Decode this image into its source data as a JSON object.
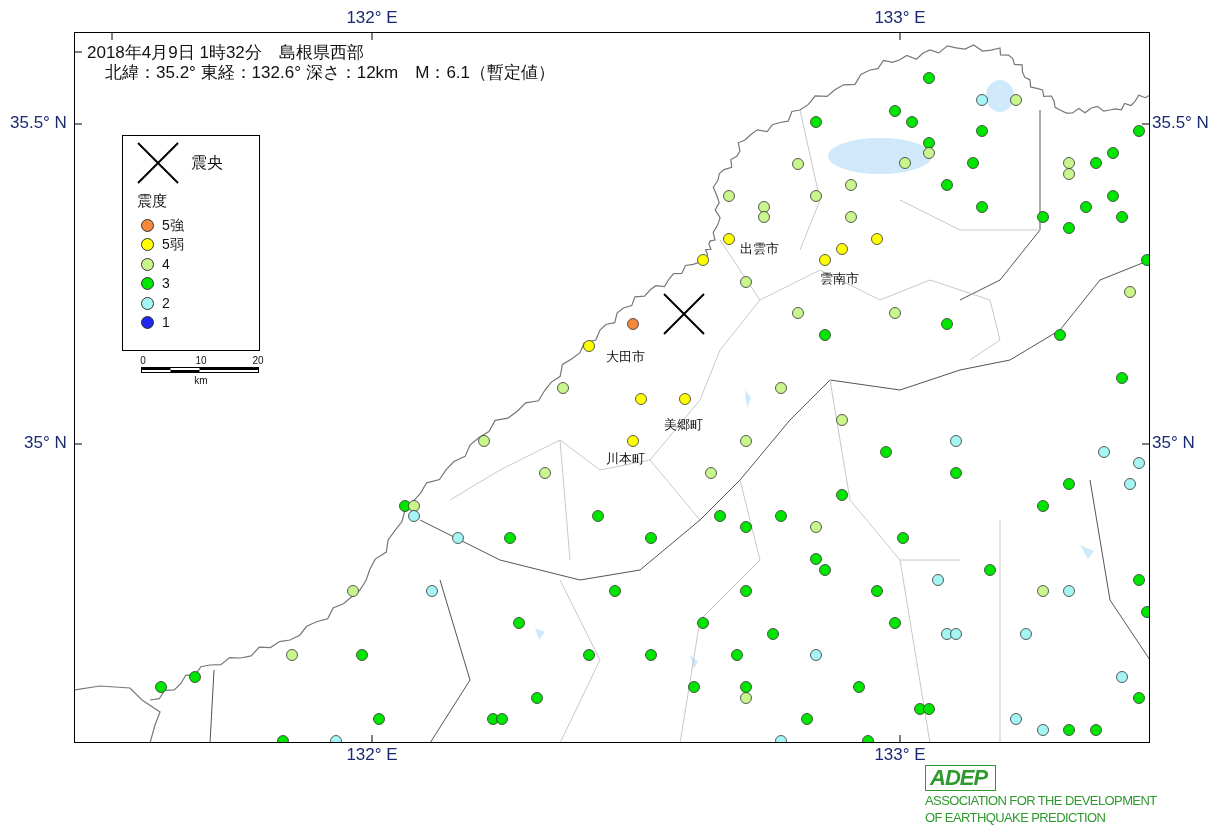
{
  "header": {
    "line_1": "2018年4月9日 1時32分　島根県西部",
    "line_2": "北緯：35.2°  東経：132.6°  深さ：12km　M：6.1（暫定値）"
  },
  "axes": {
    "top": [
      "132° E",
      "133° E"
    ],
    "bottom": [
      "132° E",
      "133° E"
    ],
    "left": [
      "35.5° N",
      "35° N"
    ],
    "right": [
      "35.5° N",
      "35° N"
    ]
  },
  "legend": {
    "epicenter_label": "震央",
    "intensity_title": "震度",
    "intensity_levels": [
      {
        "label": "5強",
        "color": "#f5883a"
      },
      {
        "label": "5弱",
        "color": "#ffff00"
      },
      {
        "label": "4",
        "color": "#c8f58c"
      },
      {
        "label": "3",
        "color": "#00e600"
      },
      {
        "label": "2",
        "color": "#a5f5f5"
      },
      {
        "label": "1",
        "color": "#1e28f0"
      }
    ],
    "scale": {
      "ticks": [
        "0",
        "10",
        "20"
      ],
      "unit": "km"
    }
  },
  "place_labels": [
    "出雲市",
    "雲南市",
    "大田市",
    "美郷町",
    "川本町"
  ],
  "stations": [
    {
      "color": "#00e600"
    },
    {
      "color": "#c8f58c"
    },
    {
      "color": "#a5f5f5"
    },
    {
      "color": "#00e600"
    },
    {
      "color": "#00e600"
    },
    {
      "color": "#00e600"
    },
    {
      "color": "#00e600"
    },
    {
      "color": "#00e600"
    },
    {
      "color": "#00e600"
    },
    {
      "color": "#c8f58c"
    },
    {
      "color": "#c8f58c"
    },
    {
      "color": "#00e600"
    },
    {
      "color": "#c8f58c"
    },
    {
      "color": "#00e600"
    },
    {
      "color": "#00e600"
    },
    {
      "color": "#c8f58c"
    },
    {
      "color": "#c8f58c"
    },
    {
      "color": "#c8f58c"
    },
    {
      "color": "#c8f58c"
    },
    {
      "color": "#00e600"
    },
    {
      "color": "#c8f58c"
    },
    {
      "color": "#c8f58c"
    },
    {
      "color": "#c8f58c"
    },
    {
      "color": "#00e600"
    },
    {
      "color": "#00e600"
    },
    {
      "color": "#00e600"
    },
    {
      "color": "#00e600"
    },
    {
      "color": "#00e600"
    },
    {
      "color": "#c8f58c"
    },
    {
      "color": "#00e600"
    },
    {
      "color": "#ffff00"
    },
    {
      "color": "#ffff00"
    },
    {
      "color": "#ffff00"
    },
    {
      "color": "#ffff00"
    },
    {
      "color": "#ffff00"
    },
    {
      "color": "#00e600"
    },
    {
      "color": "#c8f58c"
    },
    {
      "color": "#c8f58c"
    },
    {
      "color": "#c8f58c"
    },
    {
      "color": "#c8f58c"
    },
    {
      "color": "#00e600"
    },
    {
      "color": "#f5883a"
    },
    {
      "color": "#00e600"
    },
    {
      "color": "#00e600"
    },
    {
      "color": "#ffff00"
    },
    {
      "color": "#00e600"
    },
    {
      "color": "#c8f58c"
    },
    {
      "color": "#c8f58c"
    },
    {
      "color": "#ffff00"
    },
    {
      "color": "#ffff00"
    },
    {
      "color": "#c8f58c"
    },
    {
      "color": "#c8f58c"
    },
    {
      "color": "#ffff00"
    },
    {
      "color": "#c8f58c"
    },
    {
      "color": "#a5f5f5"
    },
    {
      "color": "#00e600"
    },
    {
      "color": "#a5f5f5"
    },
    {
      "color": "#a5f5f5"
    },
    {
      "color": "#c8f58c"
    },
    {
      "color": "#c8f58c"
    },
    {
      "color": "#00e600"
    },
    {
      "color": "#00e600"
    },
    {
      "color": "#a5f5f5"
    },
    {
      "color": "#00e600"
    },
    {
      "color": "#00e600"
    },
    {
      "color": "#c8f58c"
    },
    {
      "color": "#00e600"
    },
    {
      "color": "#a5f5f5"
    },
    {
      "color": "#00e600"
    },
    {
      "color": "#00e600"
    },
    {
      "color": "#00e600"
    },
    {
      "color": "#00e600"
    },
    {
      "color": "#c8f58c"
    },
    {
      "color": "#a5f5f5"
    },
    {
      "color": "#00e600"
    },
    {
      "color": "#00e600"
    },
    {
      "color": "#00e600"
    },
    {
      "color": "#00e600"
    },
    {
      "color": "#00e600"
    },
    {
      "color": "#00e600"
    },
    {
      "color": "#a5f5f5"
    },
    {
      "color": "#c8f58c"
    },
    {
      "color": "#a5f5f5"
    },
    {
      "color": "#00e600"
    },
    {
      "color": "#00e600"
    },
    {
      "color": "#00e600"
    },
    {
      "color": "#c8f58c"
    },
    {
      "color": "#a5f5f5"
    },
    {
      "color": "#00e600"
    },
    {
      "color": "#00e600"
    },
    {
      "color": "#00e600"
    },
    {
      "color": "#00e600"
    },
    {
      "color": "#00e600"
    },
    {
      "color": "#00e600"
    },
    {
      "color": "#a5f5f5"
    },
    {
      "color": "#a5f5f5"
    },
    {
      "color": "#a5f5f5"
    },
    {
      "color": "#c8f58c"
    },
    {
      "color": "#00e600"
    },
    {
      "color": "#00e600"
    },
    {
      "color": "#00e600"
    },
    {
      "color": "#00e600"
    },
    {
      "color": "#a5f5f5"
    },
    {
      "color": "#00e600"
    },
    {
      "color": "#00e600"
    },
    {
      "color": "#00e600"
    },
    {
      "color": "#00e600"
    },
    {
      "color": "#00e600"
    },
    {
      "color": "#a5f5f5"
    },
    {
      "color": "#c8f58c"
    },
    {
      "color": "#00e600"
    },
    {
      "color": "#00e600"
    },
    {
      "color": "#00e600"
    },
    {
      "color": "#00e600"
    },
    {
      "color": "#00e600"
    },
    {
      "color": "#00e600"
    },
    {
      "color": "#00e600"
    },
    {
      "color": "#00e600"
    },
    {
      "color": "#a5f5f5"
    },
    {
      "color": "#a5f5f5"
    },
    {
      "color": "#00e600"
    },
    {
      "color": "#00e600"
    },
    {
      "color": "#00e600"
    },
    {
      "color": "#a5f5f5"
    },
    {
      "color": "#a5f5f5"
    },
    {
      "color": "#00e600"
    }
  ],
  "logo": {
    "mark": "ADEP",
    "line_1": "ASSOCIATION FOR THE DEVELOPMENT",
    "line_2": "OF EARTHQUAKE PREDICTION"
  }
}
